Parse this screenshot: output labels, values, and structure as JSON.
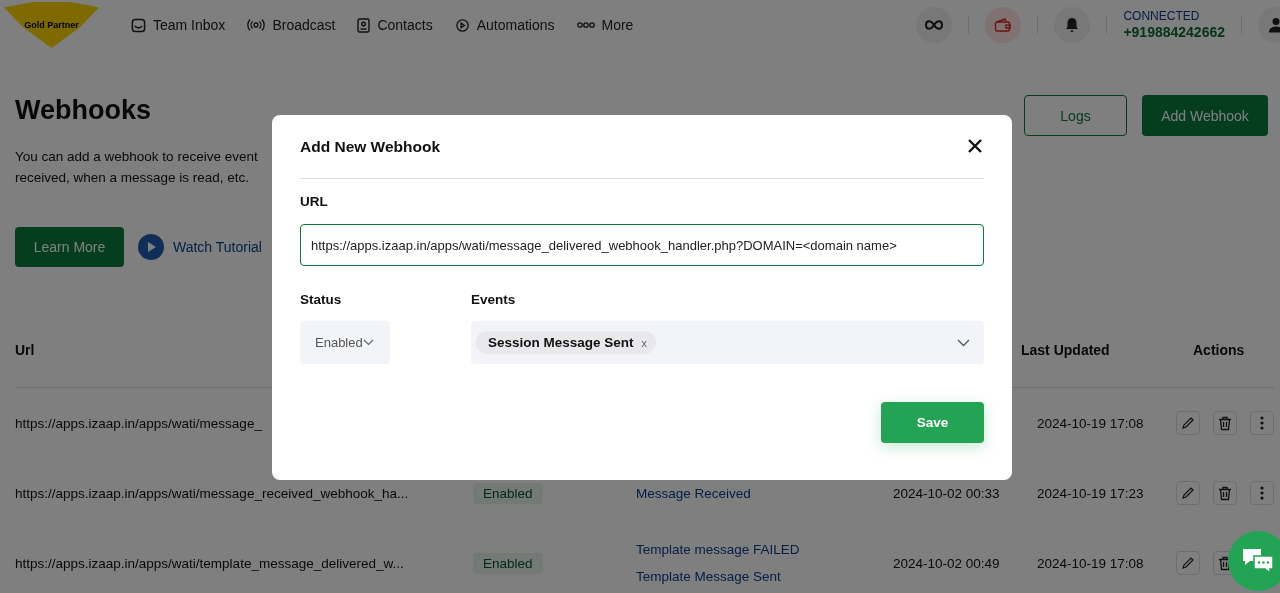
{
  "header": {
    "logo_text": "Gold Partner",
    "nav": [
      {
        "label": "Team Inbox"
      },
      {
        "label": "Broadcast"
      },
      {
        "label": "Contacts"
      },
      {
        "label": "Automations"
      },
      {
        "label": "More"
      }
    ],
    "connection_status": "CONNECTED",
    "phone": "+919884242662"
  },
  "page": {
    "title": "Webhooks",
    "description_lines": [
      "You can add a webhook to receive event",
      "received, when a message is read, etc."
    ],
    "learn_more": "Learn More",
    "watch_tutorial": "Watch Tutorial",
    "logs": "Logs",
    "add_webhook": "Add Webhook"
  },
  "table": {
    "columns": {
      "url": "Url",
      "last_updated": "Last Updated",
      "actions": "Actions"
    },
    "rows": [
      {
        "url": "https://apps.izaap.in/apps/wati/message_",
        "last_updated": "2024-10-19 17:08"
      },
      {
        "url": "https://apps.izaap.in/apps/wati/message_received_webhook_ha...",
        "status": "Enabled",
        "events": [
          "Message Received"
        ],
        "created": "2024-10-02 00:33",
        "last_updated": "2024-10-19 17:23"
      },
      {
        "url": "https://apps.izaap.in/apps/wati/template_message_delivered_w...",
        "status": "Enabled",
        "events": [
          "Template message FAILED",
          "Template Message Sent"
        ],
        "created": "2024-10-02 00:49",
        "last_updated": "2024-10-19 17:08"
      }
    ]
  },
  "modal": {
    "title": "Add New Webhook",
    "url_label": "URL",
    "url_value": "https://apps.izaap.in/apps/wati/message_delivered_webhook_handler.php?DOMAIN=<domain name>",
    "status_label": "Status",
    "status_value": "Enabled",
    "events_label": "Events",
    "events": [
      {
        "label": "Session Message Sent",
        "remove": "x"
      }
    ],
    "save": "Save"
  }
}
